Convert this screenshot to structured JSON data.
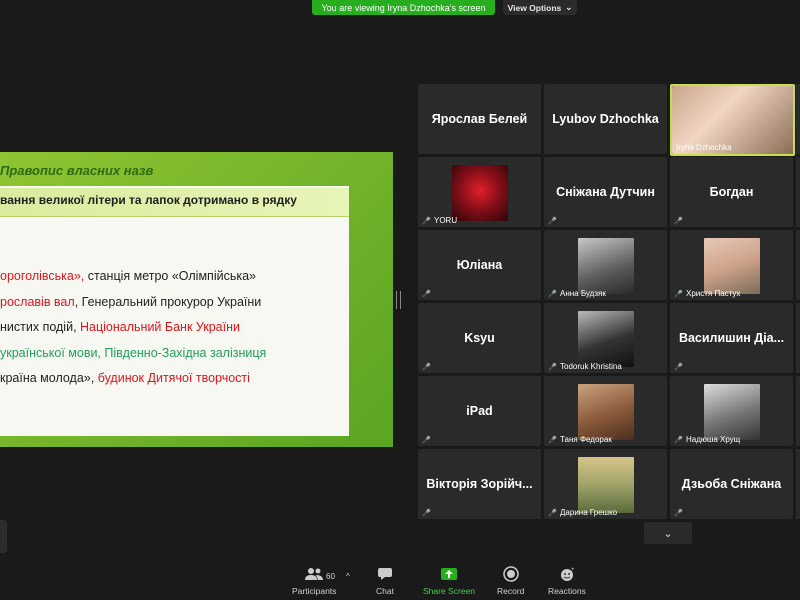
{
  "banner": {
    "text": "You are viewing Iryna Dzhochka's screen"
  },
  "view_options": {
    "label": "View Options",
    "chevron_icon": "chevron-down-icon"
  },
  "slide": {
    "title": "Правопис власних назв",
    "subtitle": "вання великої літери та лапок дотримано в рядку",
    "lines": [
      [
        {
          "t": "ороголівська»,",
          "c": "red"
        },
        {
          "t": " станція метро «Олімпійська»",
          "c": "black"
        }
      ],
      [
        {
          "t": "рославів вал",
          "c": "red"
        },
        {
          "t": ", Генеральний прокурор України",
          "c": "black"
        }
      ],
      [
        {
          "t": "нистих подій, ",
          "c": "black"
        },
        {
          "t": "Національний Банк України",
          "c": "red"
        }
      ],
      [
        {
          "t": "української мови, Південно-Західна залізниця",
          "c": "green"
        }
      ],
      [
        {
          "t": "країна молода», ",
          "c": "black"
        },
        {
          "t": "будинок Дитячої творчості",
          "c": "red"
        }
      ]
    ]
  },
  "participants": [
    {
      "name": "Ярослав Белей",
      "type": "name"
    },
    {
      "name": "Lyubov Dzhochka",
      "type": "name"
    },
    {
      "name": "Iryna Dzhochka",
      "type": "video",
      "active": true,
      "muted": false
    },
    {
      "name": "YORU",
      "type": "video",
      "muted": true
    },
    {
      "name": "Сніжана Дутчин",
      "type": "name",
      "muted": true
    },
    {
      "name": "Богдан",
      "type": "name",
      "muted": true
    },
    {
      "name": "Юліана",
      "type": "name",
      "muted": true
    },
    {
      "name": "Анна Будзяк",
      "type": "video",
      "muted": true
    },
    {
      "name": "Христя Пастух",
      "type": "video",
      "muted": true
    },
    {
      "name": "Ksyu",
      "type": "name",
      "muted": true
    },
    {
      "name": "Todoruk Khristina",
      "type": "video",
      "muted": true
    },
    {
      "name": "Василишин  Діа...",
      "type": "name",
      "muted": true
    },
    {
      "name": "iPad",
      "type": "name",
      "muted": true
    },
    {
      "name": "Таня Федорак",
      "type": "video",
      "muted": true
    },
    {
      "name": "Надюша Хрущ",
      "type": "video",
      "muted": true
    },
    {
      "name": "Вікторія Зорійч...",
      "type": "name",
      "muted": true
    },
    {
      "name": "Дарина Грешко",
      "type": "video",
      "muted": true
    },
    {
      "name": "Дзьоба Сніжана",
      "type": "name",
      "muted": true
    }
  ],
  "toolbar": {
    "participants_label": "Participants",
    "participants_count": "60",
    "chat_label": "Chat",
    "share_label": "Share Screen",
    "record_label": "Record",
    "reactions_label": "Reactions",
    "share_color": "#27ae1f"
  }
}
